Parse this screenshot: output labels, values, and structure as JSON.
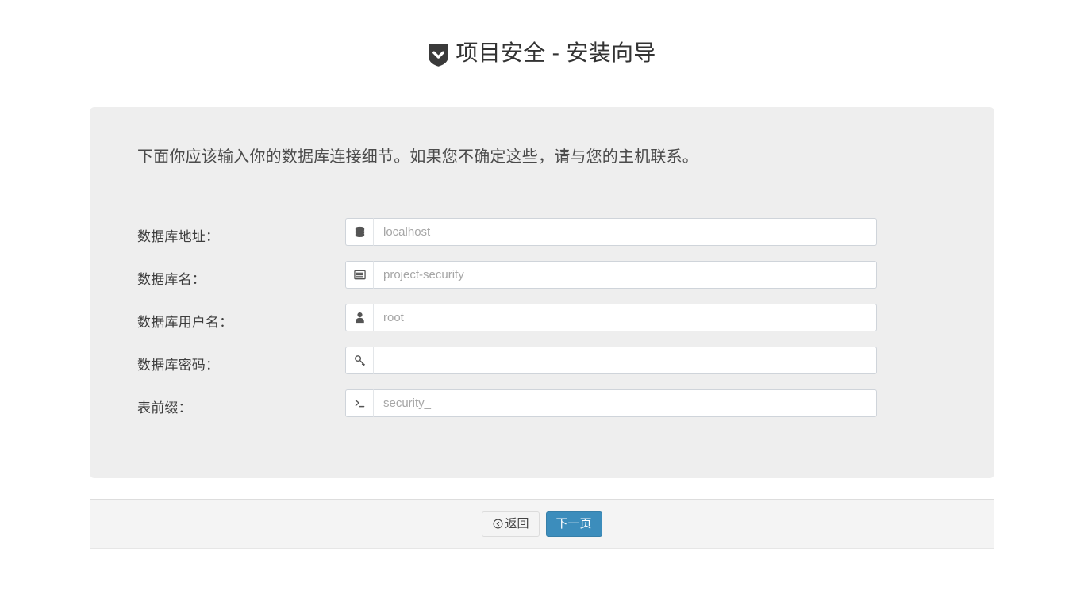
{
  "header": {
    "brand_icon": "shield-chevron-down-icon",
    "brand_icon_color": "#3a3a3a",
    "title": "项目安全 - 安装向导"
  },
  "panel": {
    "description": "下面你应该输入你的数据库连接细节。如果您不确定这些，请与您的主机联系。",
    "background_color": "#eeeeee",
    "fields": [
      {
        "label": "数据库地址：",
        "icon": "database-icon",
        "placeholder": "localhost",
        "value": "",
        "type": "text",
        "name": "db-host"
      },
      {
        "label": "数据库名：",
        "icon": "table-list-icon",
        "placeholder": "project-security",
        "value": "",
        "type": "text",
        "name": "db-name"
      },
      {
        "label": "数据库用户名：",
        "icon": "user-icon",
        "placeholder": "root",
        "value": "",
        "type": "text",
        "name": "db-user"
      },
      {
        "label": "数据库密码：",
        "icon": "key-icon",
        "placeholder": "",
        "value": "",
        "type": "password",
        "name": "db-password"
      },
      {
        "label": "表前缀：",
        "icon": "terminal-icon",
        "placeholder": "security_",
        "value": "",
        "type": "text",
        "name": "table-prefix"
      }
    ]
  },
  "footer": {
    "back_button": {
      "label": "返回",
      "icon": "arrow-circle-left-icon"
    },
    "next_button": {
      "label": "下一页",
      "color": "#3c8dbc"
    }
  }
}
